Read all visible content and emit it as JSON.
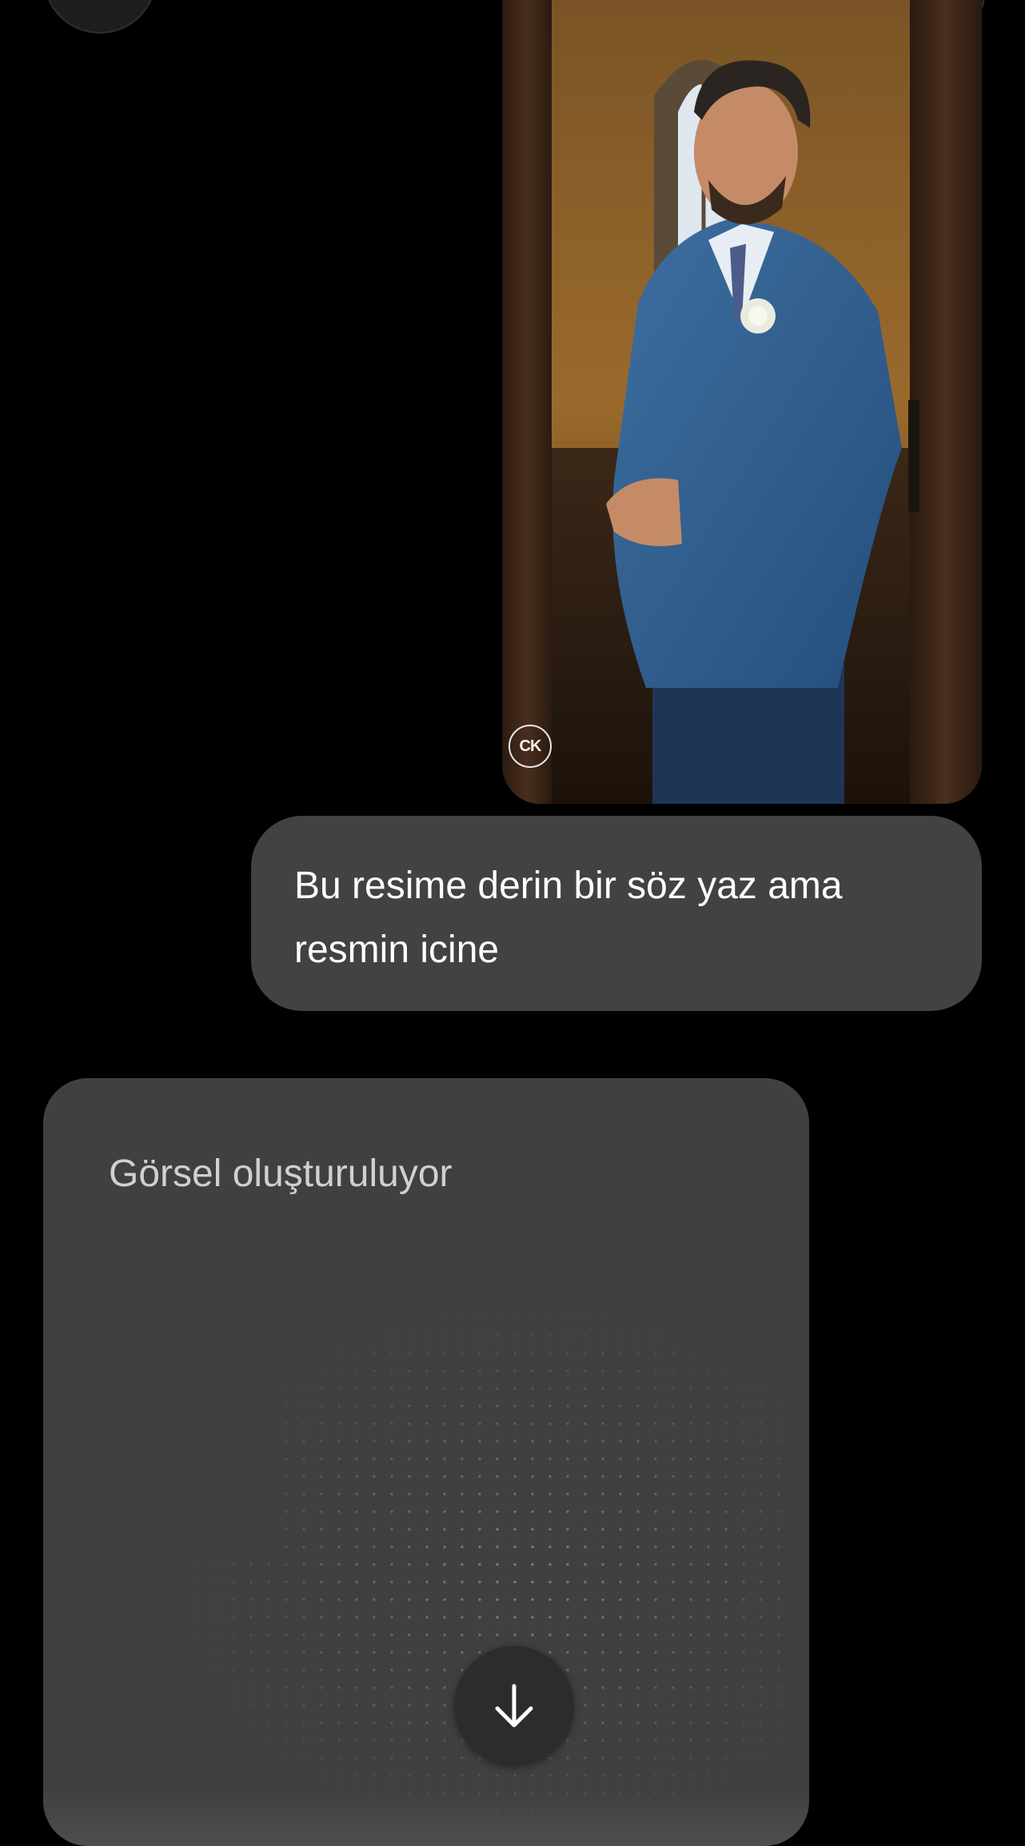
{
  "chat": {
    "user_message": {
      "text": "Bu resime derin bir söz yaz ama resmin icine"
    },
    "attachment": {
      "watermark": "CK"
    },
    "assistant": {
      "status_text": "Görsel oluşturuluyor",
      "scroll_icon": "arrow-down-icon"
    }
  },
  "colors": {
    "background": "#000000",
    "bubble": "#424242",
    "card": "#404040",
    "scroll_button": "#2c2c2c"
  }
}
